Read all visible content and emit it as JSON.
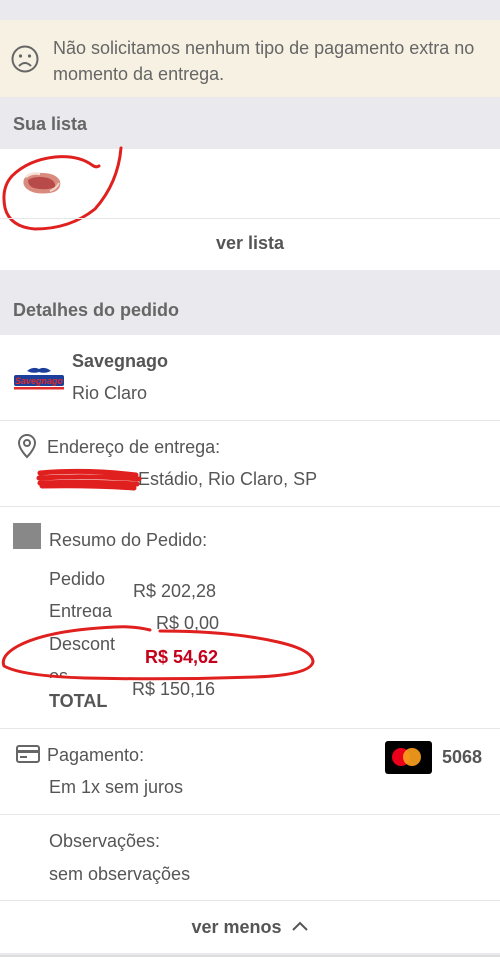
{
  "notice": {
    "text": "Não solicitamos nenhum tipo de pagamento extra no momento da entrega.",
    "icon": "sad-face-icon"
  },
  "list_section": {
    "title": "Sua lista",
    "view_list_label": "ver lista"
  },
  "order_details": {
    "title": "Detalhes do pedido",
    "store": {
      "name": "Savegnago",
      "city": "Rio Claro",
      "logo_text": "Savegnago"
    },
    "address": {
      "label": "Endereço de entrega:",
      "value": "Estádio, Rio Claro, SP"
    },
    "summary": {
      "title": "Resumo do Pedido:",
      "rows": [
        {
          "label": "Pedido",
          "value": "R$ 202,28"
        },
        {
          "label": "Entrega",
          "value": "R$ 0,00"
        },
        {
          "label": "Descont",
          "label_cont": "os",
          "value": "R$ 54,62"
        },
        {
          "label": "TOTAL",
          "value": "R$ 150,16"
        }
      ]
    },
    "payment": {
      "label": "Pagamento:",
      "installments": "Em 1x sem juros",
      "card_last4": "5068",
      "card_brand": "mastercard-icon"
    },
    "notes": {
      "label": "Observações:",
      "value": "sem observações"
    },
    "collapse_label": "ver menos"
  },
  "colors": {
    "discount": "#c4001a",
    "scribble": "#e0201e",
    "notice_bg": "#f6f1e2"
  }
}
